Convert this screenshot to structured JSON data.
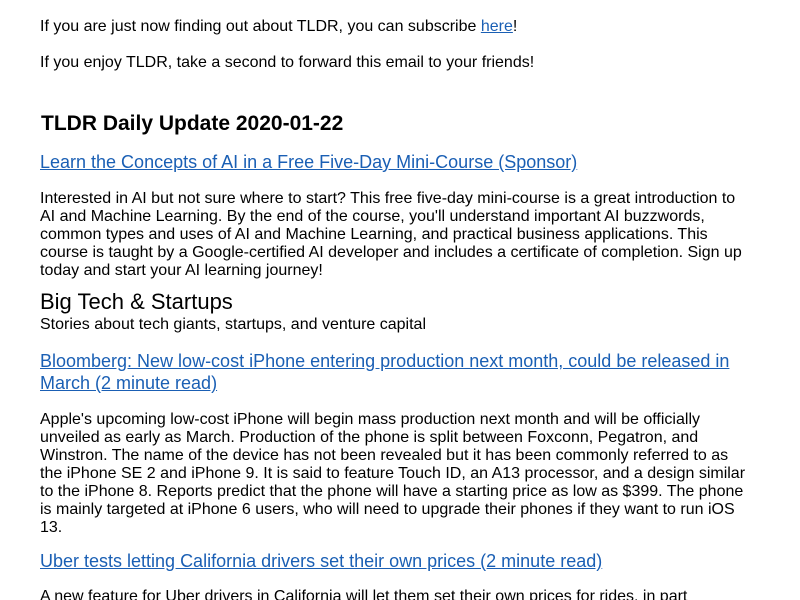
{
  "intro": {
    "subscribe_prefix": "If you are just now finding out about TLDR, you can subscribe ",
    "subscribe_link": "here",
    "subscribe_suffix": "!",
    "forward_text": "If you enjoy TLDR, take a second to forward this email to your friends!"
  },
  "header": {
    "title": "TLDR Daily Update 2020-01-22"
  },
  "sponsor": {
    "link": "Learn the Concepts of AI in a Free Five-Day Mini-Course (Sponsor)",
    "body": "Interested in AI but not sure where to start? This free five-day mini-course is a great introduction to AI and Machine Learning. By the end of the course, you'll understand important AI buzzwords, common types and uses of AI and Machine Learning, and practical business applications. This course is taught by a Google-certified AI developer and includes a certificate of completion. Sign up today and start your AI learning journey!"
  },
  "section": {
    "title": "Big Tech & Startups",
    "subtitle": "Stories about tech giants, startups, and venture capital"
  },
  "stories": [
    {
      "link": "Bloomberg: New low-cost iPhone entering production next month, could be released in March (2 minute read)",
      "body": "Apple's upcoming low-cost iPhone will begin mass production next month and will be officially unveiled as early as March. Production of the phone is split between Foxconn, Pegatron, and Winstron. The name of the device has not been revealed but it has been commonly referred to as the iPhone SE 2 and iPhone 9. It is said to feature Touch ID, an A13 processor, and a design similar to the iPhone 8. Reports predict that the phone will have a starting price as low as $399. The phone is mainly targeted at iPhone 6 users, who will need to upgrade their phones if they want to run iOS 13."
    },
    {
      "link": "Uber tests letting California drivers set their own prices (2 minute read)",
      "body": "A new feature for Uber drivers in California will let them set their own prices for rides, in part"
    }
  ]
}
